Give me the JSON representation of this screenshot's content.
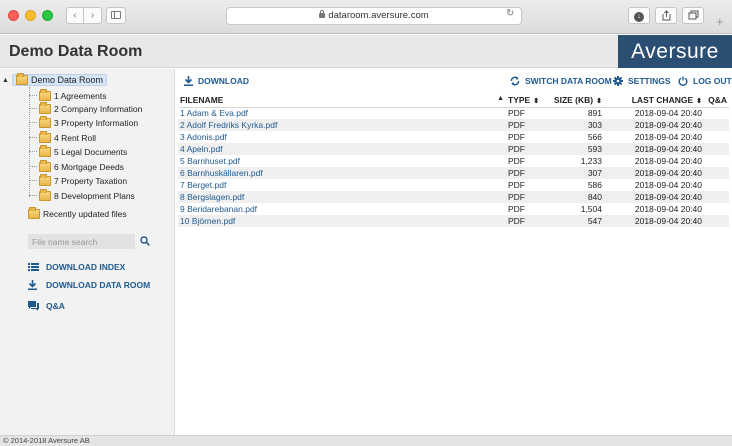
{
  "browser": {
    "url": "dataroom.aversure.com",
    "back_glyph": "‹",
    "forward_glyph": "›",
    "reload_glyph": "↻",
    "new_tab_glyph": "+"
  },
  "header": {
    "title": "Demo Data Room",
    "logo_text": "Aversure",
    "logo_bg": "#2a4f73"
  },
  "sidebar": {
    "root": {
      "label": "Demo Data Room",
      "expander": "▲"
    },
    "folders": [
      "1 Agreements",
      "2 Company Information",
      "3 Property Information",
      "4 Rent Roll",
      "5 Legal Documents",
      "6 Mortgage Deeds",
      "7 Property Taxation",
      "8 Development Plans"
    ],
    "recently_updated": "Recently updated files",
    "search_placeholder": "File name search",
    "links": {
      "download_index": "DOWNLOAD INDEX",
      "download_data_room": "DOWNLOAD DATA ROOM",
      "qa": "Q&A"
    }
  },
  "toolbar": {
    "download": "DOWNLOAD",
    "switch_data_room": "SWITCH DATA ROOM",
    "settings": "SETTINGS",
    "log_out": "LOG OUT"
  },
  "table": {
    "columns": {
      "filename": "FILENAME",
      "sort_asc": "▲",
      "type": "TYPE",
      "size": "SIZE (KB)",
      "last_change": "LAST CHANGE",
      "sort_both": "⬍",
      "qa": "Q&A"
    },
    "rows": [
      {
        "name": "1 Adam & Eva.pdf",
        "type": "PDF",
        "size": "891",
        "date": "2018-09-04 20:40"
      },
      {
        "name": "2 Adolf Fredriks Kyrka.pdf",
        "type": "PDF",
        "size": "303",
        "date": "2018-09-04 20:40"
      },
      {
        "name": "3 Adonis.pdf",
        "type": "PDF",
        "size": "566",
        "date": "2018-09-04 20:40"
      },
      {
        "name": "4 Apeln.pdf",
        "type": "PDF",
        "size": "593",
        "date": "2018-09-04 20:40"
      },
      {
        "name": "5 Barnhuset.pdf",
        "type": "PDF",
        "size": "1,233",
        "date": "2018-09-04 20:40"
      },
      {
        "name": "6 Barnhuskällaren.pdf",
        "type": "PDF",
        "size": "307",
        "date": "2018-09-04 20:40"
      },
      {
        "name": "7 Berget.pdf",
        "type": "PDF",
        "size": "586",
        "date": "2018-09-04 20:40"
      },
      {
        "name": "8 Bergslagen.pdf",
        "type": "PDF",
        "size": "840",
        "date": "2018-09-04 20:40"
      },
      {
        "name": "9 Beridarebanan.pdf",
        "type": "PDF",
        "size": "1,504",
        "date": "2018-09-04 20:40"
      },
      {
        "name": "10 Björnen.pdf",
        "type": "PDF",
        "size": "547",
        "date": "2018-09-04 20:40"
      }
    ]
  },
  "footer": {
    "copyright": "© 2014-2018 Aversure AB"
  },
  "colors": {
    "link": "#1f5a8f",
    "row_alt": "#efefef",
    "selected": "#d6e6f7"
  }
}
